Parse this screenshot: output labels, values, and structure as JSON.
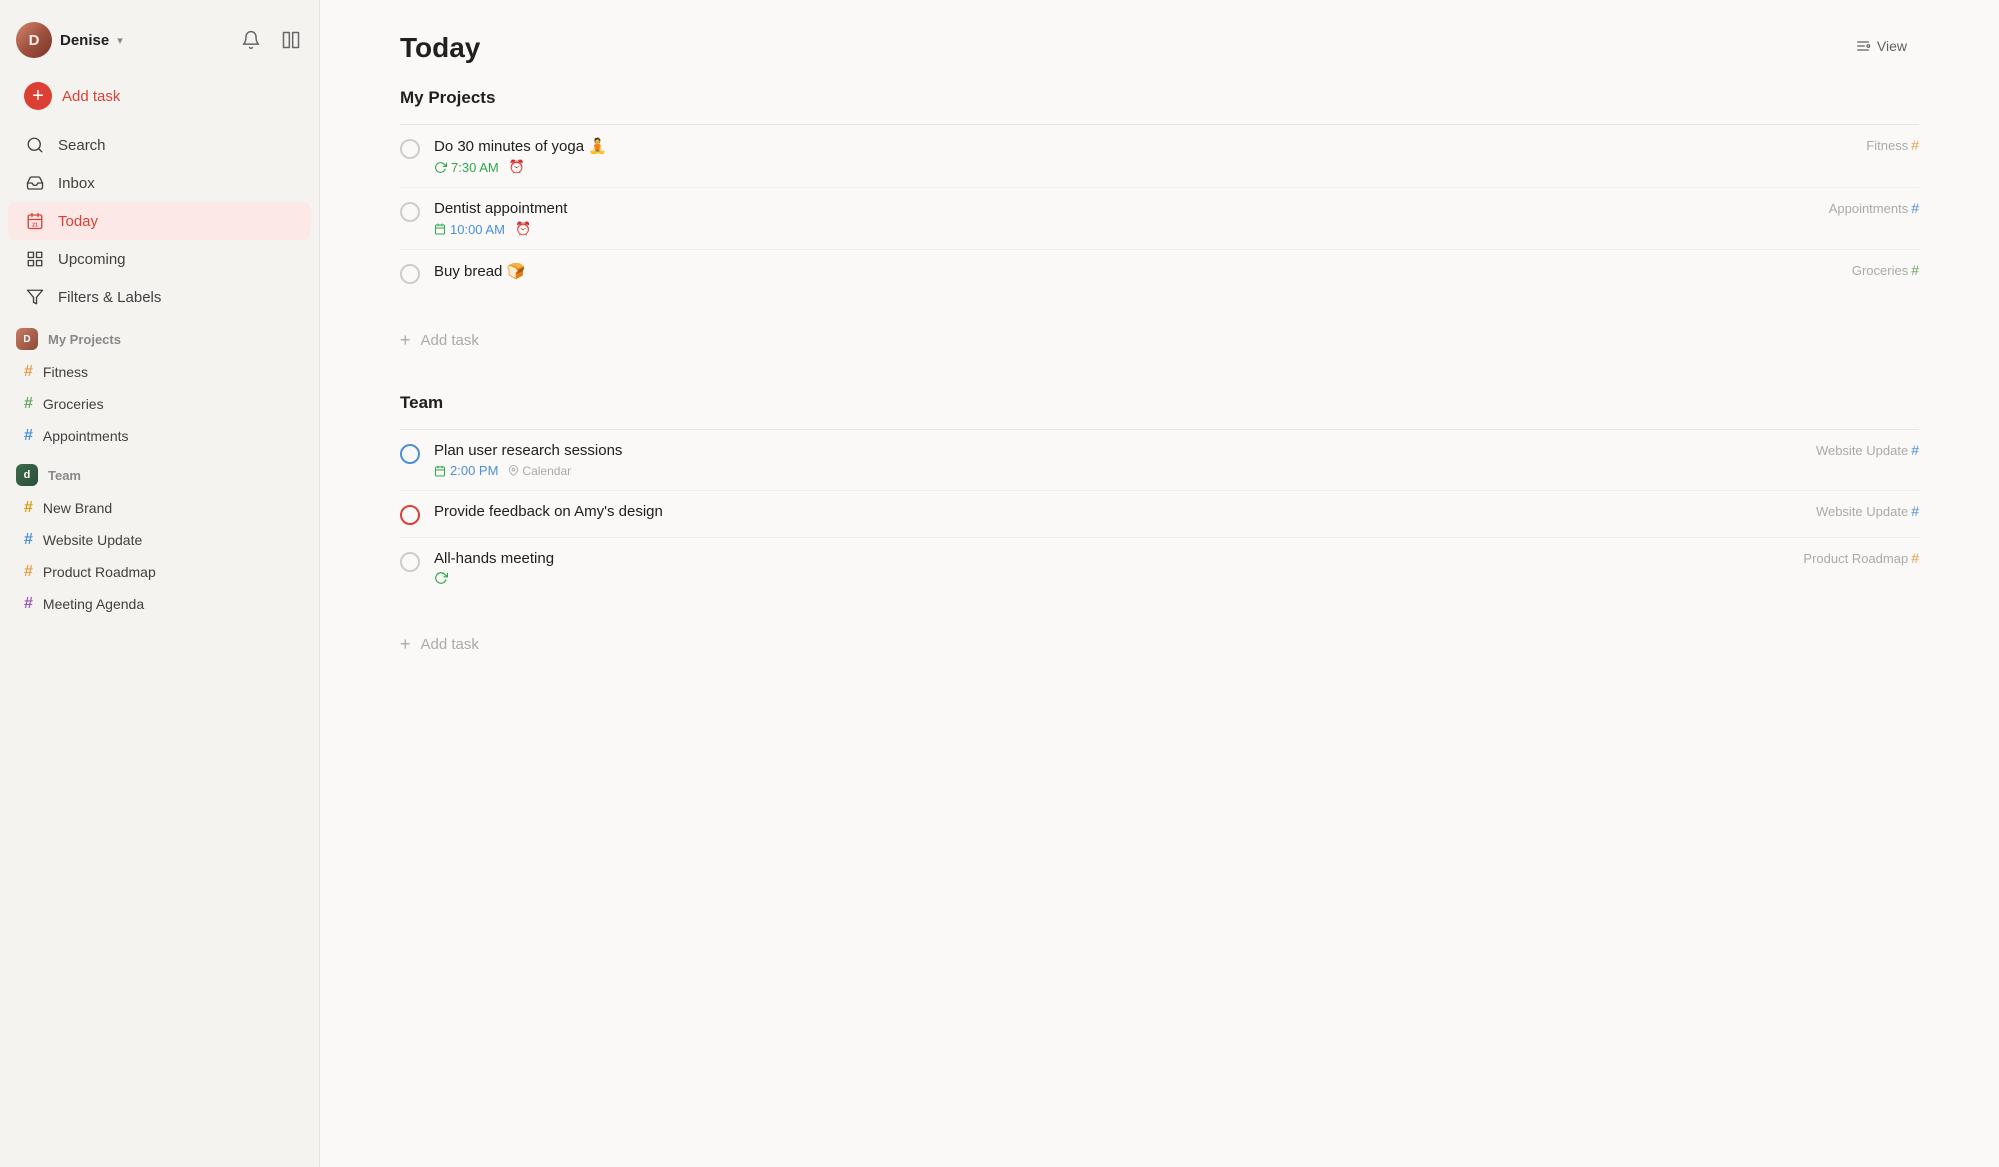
{
  "sidebar": {
    "user": {
      "name": "Denise",
      "initials": "D"
    },
    "nav": [
      {
        "id": "add-task",
        "label": "Add task",
        "icon": "plus-circle",
        "active": false,
        "accent": true
      },
      {
        "id": "search",
        "label": "Search",
        "icon": "search"
      },
      {
        "id": "inbox",
        "label": "Inbox",
        "icon": "inbox"
      },
      {
        "id": "today",
        "label": "Today",
        "icon": "calendar-today",
        "active": true
      }
    ],
    "filters": {
      "label": "Filters & Labels",
      "icon": "filter"
    },
    "upcoming": {
      "label": "Upcoming",
      "icon": "grid"
    },
    "my_projects_label": "My Projects",
    "my_projects": [
      {
        "id": "fitness",
        "label": "Fitness",
        "hashColor": "hash-orange"
      },
      {
        "id": "groceries",
        "label": "Groceries",
        "hashColor": "hash-green"
      },
      {
        "id": "appointments",
        "label": "Appointments",
        "hashColor": "hash-blue"
      }
    ],
    "team_label": "Team",
    "team_projects": [
      {
        "id": "new-brand",
        "label": "New Brand",
        "hashColor": "hash-yellow"
      },
      {
        "id": "website-update",
        "label": "Website Update",
        "hashColor": "hash-blue"
      },
      {
        "id": "product-roadmap",
        "label": "Product Roadmap",
        "hashColor": "hash-orange"
      },
      {
        "id": "meeting-agenda",
        "label": "Meeting Agenda",
        "hashColor": "hash-purple"
      }
    ]
  },
  "main": {
    "title": "Today",
    "view_btn": "View",
    "my_projects_section": {
      "label": "My Projects",
      "tasks": [
        {
          "id": "task-yoga",
          "name": "Do 30 minutes of yoga 🧘",
          "time": "7:30 AM",
          "time_color": "green",
          "has_alarm": true,
          "project": "Fitness",
          "project_hash_color": "#e8a04c"
        },
        {
          "id": "task-dentist",
          "name": "Dentist appointment",
          "time": "10:00 AM",
          "time_color": "blue",
          "has_alarm": true,
          "has_calendar": true,
          "project": "Appointments",
          "project_hash_color": "#4a90d9"
        },
        {
          "id": "task-bread",
          "name": "Buy bread 🍞",
          "time": null,
          "project": "Groceries",
          "project_hash_color": "#6aaa64"
        }
      ],
      "add_task_label": "Add task"
    },
    "team_section": {
      "label": "Team",
      "tasks": [
        {
          "id": "task-research",
          "name": "Plan user research sessions",
          "time": "2:00 PM",
          "time_color": "blue",
          "has_calendar": true,
          "has_location": true,
          "location": "Calendar",
          "checkbox_style": "blue-outline",
          "project": "Website Update",
          "project_hash_color": "#4a90d9"
        },
        {
          "id": "task-feedback",
          "name": "Provide feedback on Amy's design",
          "time": null,
          "checkbox_style": "red-outline",
          "project": "Website Update",
          "project_hash_color": "#4a90d9"
        },
        {
          "id": "task-allhands",
          "name": "All-hands meeting",
          "time": null,
          "has_recur": true,
          "checkbox_style": "normal",
          "project": "Product Roadmap",
          "project_hash_color": "#e8a04c"
        }
      ],
      "add_task_label": "Add task"
    }
  }
}
